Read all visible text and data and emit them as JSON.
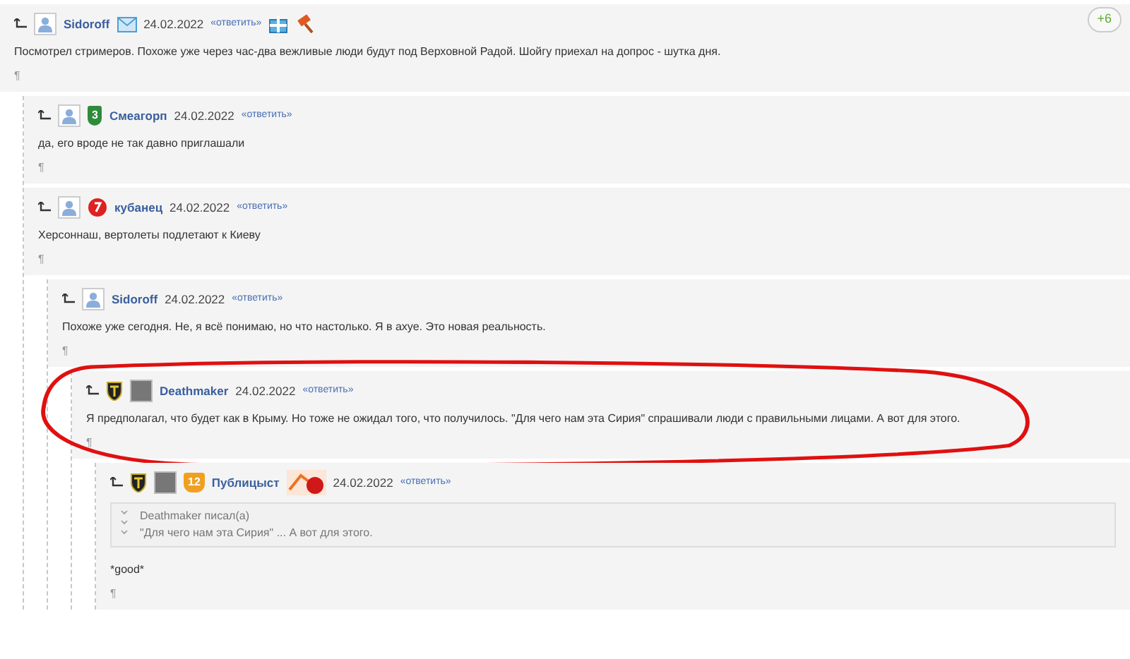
{
  "comments": [
    {
      "header": [
        {
          "kind": "avatar"
        },
        {
          "kind": "author",
          "text": "Sidoroff"
        },
        {
          "kind": "mail"
        },
        {
          "kind": "date",
          "text": "24.02.2022"
        },
        {
          "kind": "reply",
          "text": "«ответить»"
        },
        {
          "kind": "gift"
        },
        {
          "kind": "hammer"
        }
      ],
      "rating": "+6",
      "text": "Посмотрел стримеров. Похоже уже через час-два вежливые люди будут под Верховной Радой. Шойгу приехал на допрос - шутка дня.",
      "pilcrow": "¶",
      "children": [
        {
          "header": [
            {
              "kind": "avatar"
            },
            {
              "kind": "rank",
              "text": "3",
              "color": "#2e8b3a"
            },
            {
              "kind": "author",
              "text": "Смеагорп"
            },
            {
              "kind": "date",
              "text": "24.02.2022"
            },
            {
              "kind": "reply",
              "text": "«ответить»"
            }
          ],
          "text": "да, его вроде не так давно приглашали",
          "pilcrow": "¶"
        },
        {
          "header": [
            {
              "kind": "avatar"
            },
            {
              "kind": "medal"
            },
            {
              "kind": "author",
              "text": "кубанец"
            },
            {
              "kind": "date",
              "text": "24.02.2022"
            },
            {
              "kind": "reply",
              "text": "«ответить»"
            }
          ],
          "text": "Херсоннаш, вертолеты подлетают к Киеву",
          "pilcrow": "¶",
          "children": [
            {
              "header": [
                {
                  "kind": "avatar"
                },
                {
                  "kind": "author",
                  "text": "Sidoroff"
                },
                {
                  "kind": "date",
                  "text": "24.02.2022"
                },
                {
                  "kind": "reply",
                  "text": "«ответить»"
                }
              ],
              "text": "Похоже уже сегодня. Не, я всё понимаю, но что настолько. Я в ахуе. Это новая реальность.",
              "pilcrow": "¶",
              "children": [
                {
                  "header": [
                    {
                      "kind": "shield"
                    },
                    {
                      "kind": "photo"
                    },
                    {
                      "kind": "author",
                      "text": "Deathmaker"
                    },
                    {
                      "kind": "date",
                      "text": "24.02.2022"
                    },
                    {
                      "kind": "reply",
                      "text": "«ответить»"
                    }
                  ],
                  "text": "Я предполагал, что будет как в Крыму. Но тоже не ожидал того, что получилось. \"Для чего нам эта Сирия\" спрашивали люди с правильными лицами. А вот для этого.",
                  "pilcrow": "¶",
                  "circled": true,
                  "children": [
                    {
                      "header": [
                        {
                          "kind": "shield"
                        },
                        {
                          "kind": "photo"
                        },
                        {
                          "kind": "rank",
                          "text": "12",
                          "color": "#f0a020"
                        },
                        {
                          "kind": "author",
                          "text": "Публицыст"
                        },
                        {
                          "kind": "event"
                        },
                        {
                          "kind": "date",
                          "text": "24.02.2022"
                        },
                        {
                          "kind": "reply",
                          "text": "«ответить»"
                        }
                      ],
                      "quote": {
                        "author_line": "Deathmaker писал(а)",
                        "text": "\"Для чего нам эта Сирия\" ... А вот для этого."
                      },
                      "text": "*good*",
                      "pilcrow": "¶"
                    }
                  ]
                }
              ]
            }
          ]
        }
      ]
    }
  ]
}
